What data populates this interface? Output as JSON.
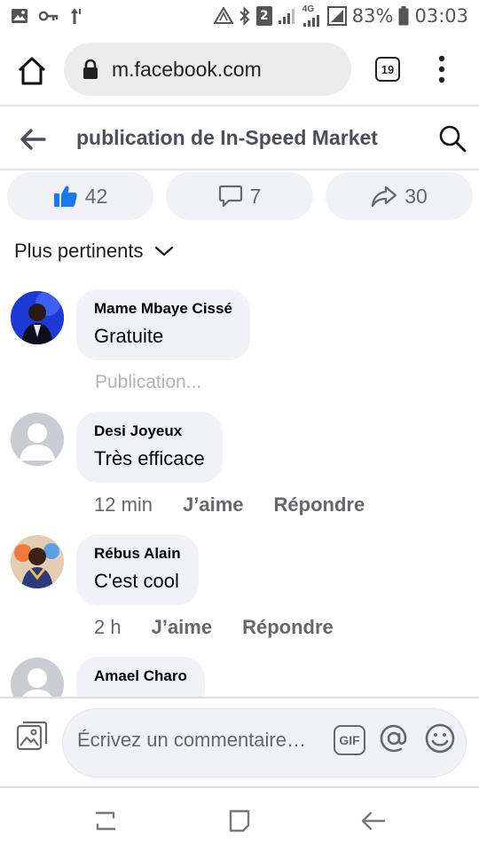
{
  "status_bar": {
    "left_icons": [
      "image-icon",
      "key-icon",
      "data-arrows-icon"
    ],
    "right_icons": [
      "data-saver-icon",
      "bluetooth-icon",
      "sim-2-icon",
      "signal-icon",
      "signal-4g-icon",
      "battery-icon"
    ],
    "sim_label": "2",
    "network_label": "4G",
    "battery": "83%",
    "time": "03:03"
  },
  "browser": {
    "url": "m.facebook.com",
    "tab_count": "19"
  },
  "header": {
    "title": "publication de In-Speed Market"
  },
  "reactions": {
    "likes": "42",
    "comments": "7",
    "shares": "30"
  },
  "sort": {
    "label": "Plus pertinents"
  },
  "comments": [
    {
      "name": "Mame Mbaye Cissé",
      "text": "Gratuite",
      "status": "Publication..."
    },
    {
      "name": "Desi Joyeux",
      "text": "Très efficace",
      "time": "12 min",
      "like": "J’aime",
      "reply": "Répondre"
    },
    {
      "name": "Rébus Alain",
      "text": "C'est cool",
      "time": "2 h",
      "like": "J’aime",
      "reply": "Répondre"
    },
    {
      "name": "Amael Charo"
    }
  ],
  "composer": {
    "placeholder": "Écrivez un commentaire…",
    "gif_label": "GIF"
  },
  "colors": {
    "like_blue": "#1877f2",
    "pill_bg": "#f0f2f5",
    "muted_text": "#65676b"
  }
}
